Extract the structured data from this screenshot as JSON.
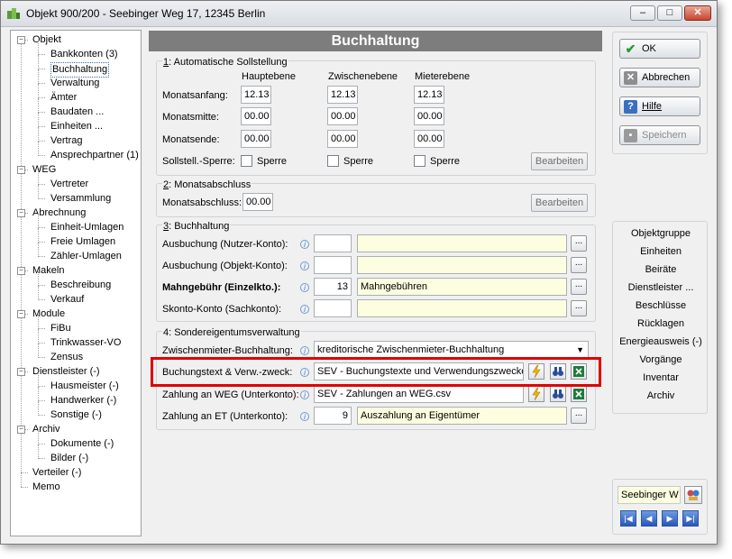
{
  "window": {
    "title": "Objekt 900/200 - Seebinger Weg 17, 12345 Berlin",
    "min": "–",
    "max": "□",
    "close": "✕"
  },
  "tree": [
    {
      "label": "Objekt",
      "level": 0,
      "expand": "−"
    },
    {
      "label": "Bankkonten (3)",
      "level": 1
    },
    {
      "label": "Buchhaltung",
      "level": 1,
      "selected": true
    },
    {
      "label": "Verwaltung",
      "level": 1
    },
    {
      "label": "Ämter",
      "level": 1
    },
    {
      "label": "Baudaten ...",
      "level": 1
    },
    {
      "label": "Einheiten ...",
      "level": 1
    },
    {
      "label": "Vertrag",
      "level": 1
    },
    {
      "label": "Ansprechpartner (1)",
      "level": 1
    },
    {
      "label": "WEG",
      "level": 0,
      "expand": "−"
    },
    {
      "label": "Vertreter",
      "level": 1
    },
    {
      "label": "Versammlung",
      "level": 1
    },
    {
      "label": "Abrechnung",
      "level": 0,
      "expand": "−"
    },
    {
      "label": "Einheit-Umlagen",
      "level": 1
    },
    {
      "label": "Freie Umlagen",
      "level": 1
    },
    {
      "label": "Zähler-Umlagen",
      "level": 1
    },
    {
      "label": "Makeln",
      "level": 0,
      "expand": "−"
    },
    {
      "label": "Beschreibung",
      "level": 1
    },
    {
      "label": "Verkauf",
      "level": 1
    },
    {
      "label": "Module",
      "level": 0,
      "expand": "−"
    },
    {
      "label": "FiBu",
      "level": 1
    },
    {
      "label": "Trinkwasser-VO",
      "level": 1
    },
    {
      "label": "Zensus",
      "level": 1
    },
    {
      "label": "Dienstleister (-)",
      "level": 0,
      "expand": "−"
    },
    {
      "label": "Hausmeister (-)",
      "level": 1
    },
    {
      "label": "Handwerker (-)",
      "level": 1
    },
    {
      "label": "Sonstige (-)",
      "level": 1
    },
    {
      "label": "Archiv",
      "level": 0,
      "expand": "−"
    },
    {
      "label": "Dokumente (-)",
      "level": 1
    },
    {
      "label": "Bilder (-)",
      "level": 1
    },
    {
      "label": "Verteiler (-)",
      "level": 0
    },
    {
      "label": "Memo",
      "level": 0
    }
  ],
  "header": "Buchhaltung",
  "sollstellung": {
    "title_u": "1",
    "title": ": Automatische Sollstellung",
    "cols": [
      "Hauptebene",
      "Zwischenebene",
      "Mieterebene"
    ],
    "rows": [
      {
        "label": "Monatsanfang:",
        "values": [
          "12.13",
          "12.13",
          "12.13"
        ]
      },
      {
        "label": "Monatsmitte:",
        "values": [
          "00.00",
          "00.00",
          "00.00"
        ]
      },
      {
        "label": "Monatsende:",
        "values": [
          "00.00",
          "00.00",
          "00.00"
        ]
      }
    ],
    "sperre_label": "Sollstell.-Sperre:",
    "sperre": "Sperre",
    "edit": "Bearbeiten"
  },
  "monatsabschluss": {
    "title_u": "2",
    "title": ": Monatsabschluss",
    "label": "Monatsabschluss:",
    "value": "00.00",
    "edit": "Bearbeiten"
  },
  "buchhaltung": {
    "title_u": "3",
    "title": ": Buchhaltung",
    "rows": [
      {
        "label": "Ausbuchung (Nutzer-Konto):",
        "num": "",
        "text": "",
        "bold": false
      },
      {
        "label": "Ausbuchung (Objekt-Konto):",
        "num": "",
        "text": "",
        "bold": false
      },
      {
        "label": "Mahngebühr (Einzelkto.):",
        "num": "13",
        "text": "Mahngebühren",
        "bold": true
      },
      {
        "label": "Skonto-Konto (Sachkonto):",
        "num": "",
        "text": "",
        "bold": false
      }
    ]
  },
  "sev": {
    "title": "4: Sondereigentumsverwaltung",
    "zwischen_label": "Zwischenmieter-Buchhaltung:",
    "zwischen_value": "kreditorische Zwischenmieter-Buchhaltung",
    "buchungstext_label": "Buchungstext & Verw.-zweck:",
    "buchungstext_value": "SEV - Buchungstexte und Verwendungszwecke",
    "zahlung_weg_label": "Zahlung an WEG (Unterkonto):",
    "zahlung_weg_value": "SEV - Zahlungen an WEG.csv",
    "zahlung_et_label": "Zahlung an ET (Unterkonto):",
    "zahlung_et_num": "9",
    "zahlung_et_text": "Auszahlung an Eigentümer"
  },
  "actions": {
    "ok": "OK",
    "cancel": "Abbrechen",
    "help": "Hilfe",
    "save": "Speichern"
  },
  "links": [
    "Objektgruppe",
    "Einheiten",
    "Beiräte",
    "Dienstleister ...",
    "Beschlüsse",
    "Rücklagen",
    "Energieausweis (-)",
    "Vorgänge",
    "Inventar",
    "Archiv"
  ],
  "nav": {
    "current": "Seebinger W",
    "first": "|◀",
    "prev": "◀",
    "next": "▶",
    "last": "▶|"
  },
  "dots": "...",
  "info": "i"
}
